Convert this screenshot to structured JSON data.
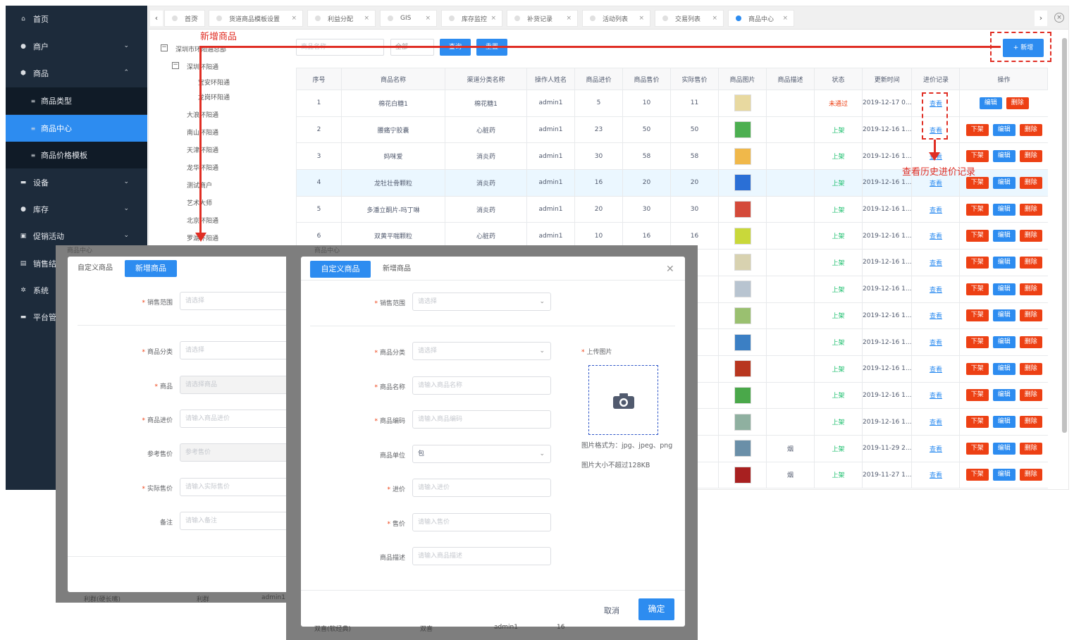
{
  "sidebar": {
    "items": [
      {
        "icon": "⌂",
        "label": "首页",
        "chev": ""
      },
      {
        "icon": "●",
        "label": "商户",
        "chev": "⌄"
      },
      {
        "icon": "⬢",
        "label": "商品",
        "chev": "⌃"
      },
      {
        "icon": "≡",
        "label": "商品类型",
        "sub": true
      },
      {
        "icon": "≡",
        "label": "商品中心",
        "sub": true,
        "active": true
      },
      {
        "icon": "≡",
        "label": "商品价格模板",
        "sub": true
      },
      {
        "icon": "▬",
        "label": "设备",
        "chev": "⌄"
      },
      {
        "icon": "●",
        "label": "库存",
        "chev": "⌄"
      },
      {
        "icon": "▣",
        "label": "促销活动",
        "chev": "⌄"
      },
      {
        "icon": "▤",
        "label": "销售结",
        "chev": ""
      },
      {
        "icon": "✲",
        "label": "系统",
        "chev": ""
      },
      {
        "icon": "▬",
        "label": "平台管",
        "chev": ""
      }
    ]
  },
  "tabs": [
    "首页",
    "货道商品模板设置",
    "利益分配",
    "GIS",
    "库存监控",
    "补货记录",
    "活动列表",
    "交易列表",
    "商品中心"
  ],
  "tree": [
    "深圳市环阳通总部",
    "深圳环阳通",
    "宝安环阳通",
    "龙岗环阳通",
    "大浪环阳通",
    "南山环阳通",
    "天津环阳通",
    "龙华环阳通",
    "测试商户",
    "艺术大师",
    "北京环阳通",
    "罗湖环阳通"
  ],
  "filter": {
    "name_placeholder": "商品名称",
    "status_value": "全部",
    "query": "查询",
    "reset": "重置",
    "add": "+ 新增"
  },
  "table": {
    "headers": [
      "序号",
      "商品名称",
      "渠道分类名称",
      "操作人姓名",
      "商品进价",
      "商品售价",
      "实际售价",
      "商品图片",
      "商品描述",
      "状态",
      "更新时间",
      "进价记录",
      "操作"
    ],
    "view_label": "查看",
    "down_label": "下架",
    "edit_label": "编辑",
    "delete_label": "删除",
    "rows": [
      {
        "no": "1",
        "name": "棉花白糖1",
        "cat": "棉花糖1",
        "op": "admin1",
        "buy": "5",
        "sell": "10",
        "real": "11",
        "desc": "",
        "status": "未通过",
        "ok": false,
        "time": "2019-12-17 0...",
        "img": "#e8d9a0"
      },
      {
        "no": "2",
        "name": "腰痛宁胶囊",
        "cat": "心脏药",
        "op": "admin1",
        "buy": "23",
        "sell": "50",
        "real": "50",
        "desc": "",
        "status": "上架",
        "ok": true,
        "time": "2019-12-16 1...",
        "img": "#4caf50"
      },
      {
        "no": "3",
        "name": "妈咪爱",
        "cat": "消炎药",
        "op": "admin1",
        "buy": "30",
        "sell": "58",
        "real": "58",
        "desc": "",
        "status": "上架",
        "ok": true,
        "time": "2019-12-16 1...",
        "img": "#f0b84a"
      },
      {
        "no": "4",
        "name": "龙牡壮骨颗粒",
        "cat": "消炎药",
        "op": "admin1",
        "buy": "16",
        "sell": "20",
        "real": "20",
        "desc": "",
        "status": "上架",
        "ok": true,
        "time": "2019-12-16 1...",
        "img": "#2a6fd6"
      },
      {
        "no": "5",
        "name": "多潘立酮片-吗丁啉",
        "cat": "消炎药",
        "op": "admin1",
        "buy": "20",
        "sell": "30",
        "real": "30",
        "desc": "",
        "status": "上架",
        "ok": true,
        "time": "2019-12-16 1...",
        "img": "#d44a3a"
      },
      {
        "no": "6",
        "name": "双黄平喘颗粒",
        "cat": "心脏药",
        "op": "admin1",
        "buy": "10",
        "sell": "16",
        "real": "16",
        "desc": "",
        "status": "上架",
        "ok": true,
        "time": "2019-12-16 1...",
        "img": "#c9d83a"
      },
      {
        "no": "",
        "name": "",
        "cat": "",
        "op": "",
        "buy": "",
        "sell": "",
        "real": "",
        "desc": "",
        "status": "上架",
        "ok": true,
        "time": "2019-12-16 1...",
        "img": "#d8d2b0"
      },
      {
        "no": "",
        "name": "",
        "cat": "",
        "op": "",
        "buy": "",
        "sell": "",
        "real": "",
        "desc": "",
        "status": "上架",
        "ok": true,
        "time": "2019-12-16 1...",
        "img": "#b8c4d0"
      },
      {
        "no": "",
        "name": "",
        "cat": "",
        "op": "",
        "buy": "",
        "sell": "",
        "real": "",
        "desc": "",
        "status": "上架",
        "ok": true,
        "time": "2019-12-16 1...",
        "img": "#9ac070"
      },
      {
        "no": "",
        "name": "",
        "cat": "",
        "op": "",
        "buy": "",
        "sell": "",
        "real": "",
        "desc": "",
        "status": "上架",
        "ok": true,
        "time": "2019-12-16 1...",
        "img": "#3b7fc4"
      },
      {
        "no": "",
        "name": "",
        "cat": "",
        "op": "",
        "buy": "",
        "sell": "",
        "real": "",
        "desc": "",
        "status": "上架",
        "ok": true,
        "time": "2019-12-16 1...",
        "img": "#b8361f"
      },
      {
        "no": "",
        "name": "",
        "cat": "",
        "op": "",
        "buy": "",
        "sell": "",
        "real": "",
        "desc": "",
        "status": "上架",
        "ok": true,
        "time": "2019-12-16 1...",
        "img": "#4aa84a"
      },
      {
        "no": "",
        "name": "",
        "cat": "",
        "op": "",
        "buy": "",
        "sell": "",
        "real": "",
        "desc": "",
        "status": "上架",
        "ok": true,
        "time": "2019-12-16 1...",
        "img": "#8fb0a0"
      },
      {
        "no": "",
        "name": "",
        "cat": "",
        "op": "",
        "buy": "",
        "sell": "",
        "real": "",
        "desc": "烟",
        "status": "上架",
        "ok": true,
        "time": "2019-11-29 2...",
        "img": "#6a8fa8"
      },
      {
        "no": "",
        "name": "",
        "cat": "",
        "op": "",
        "buy": "",
        "sell": "",
        "real": "",
        "desc": "烟",
        "status": "上架",
        "ok": true,
        "time": "2019-11-27 1...",
        "img": "#a82020"
      }
    ]
  },
  "modal_left": {
    "tab_custom": "自定义商品",
    "tab_new": "新增商品",
    "ghost_tab": "商品中心",
    "fields": [
      {
        "label": "销售范围",
        "required": true,
        "placeholder": "请选择",
        "disabled": false
      },
      {
        "label": "商品分类",
        "required": true,
        "placeholder": "请选择",
        "disabled": false
      },
      {
        "label": "商品",
        "required": true,
        "placeholder": "请选择商品",
        "disabled": true
      },
      {
        "label": "商品进价",
        "required": true,
        "placeholder": "请输入商品进价",
        "disabled": false
      },
      {
        "label": "参考售价",
        "required": false,
        "placeholder": "参考售价",
        "disabled": true
      },
      {
        "label": "实际售价",
        "required": true,
        "placeholder": "请输入实际售价",
        "disabled": false
      },
      {
        "label": "备注",
        "required": false,
        "placeholder": "请输入备注",
        "disabled": false
      }
    ],
    "bg_row": [
      "利群(硬长嘴)",
      "利群",
      "admin1"
    ]
  },
  "modal_right": {
    "tab_custom": "自定义商品",
    "tab_new": "新增商品",
    "ghost_tab": "商品中心",
    "fields": [
      {
        "label": "销售范围",
        "required": true,
        "placeholder": "请选择",
        "select": true
      },
      {
        "label": "商品分类",
        "required": true,
        "placeholder": "请选择",
        "select": true
      },
      {
        "label": "商品名称",
        "required": true,
        "placeholder": "请输入商品名称",
        "select": false
      },
      {
        "label": "商品编码",
        "required": true,
        "placeholder": "请输入商品编码",
        "select": false
      },
      {
        "label": "商品单位",
        "required": false,
        "value": "包",
        "select": true
      },
      {
        "label": "进价",
        "required": true,
        "placeholder": "请输入进价",
        "select": false
      },
      {
        "label": "售价",
        "required": true,
        "placeholder": "请输入售价",
        "select": false
      },
      {
        "label": "商品描述",
        "required": false,
        "placeholder": "请输入商品描述",
        "select": false
      }
    ],
    "upload_label": "上传图片",
    "upload_hint1": "图片格式为：jpg、jpeg、png",
    "upload_hint2": "图片大小不超过128KB",
    "cancel": "取消",
    "ok": "确定",
    "bg_row": [
      "双喜(软经典)",
      "双喜",
      "admin1",
      "16"
    ]
  },
  "annotations": {
    "add_product": "新增商品",
    "view_history": "查看历史进价记录"
  },
  "colors": {
    "primary": "#2d8cf0",
    "danger": "#ed4014",
    "success": "#19be6b",
    "sidebar": "#1d2b3b",
    "annotation": "#e02e24"
  }
}
